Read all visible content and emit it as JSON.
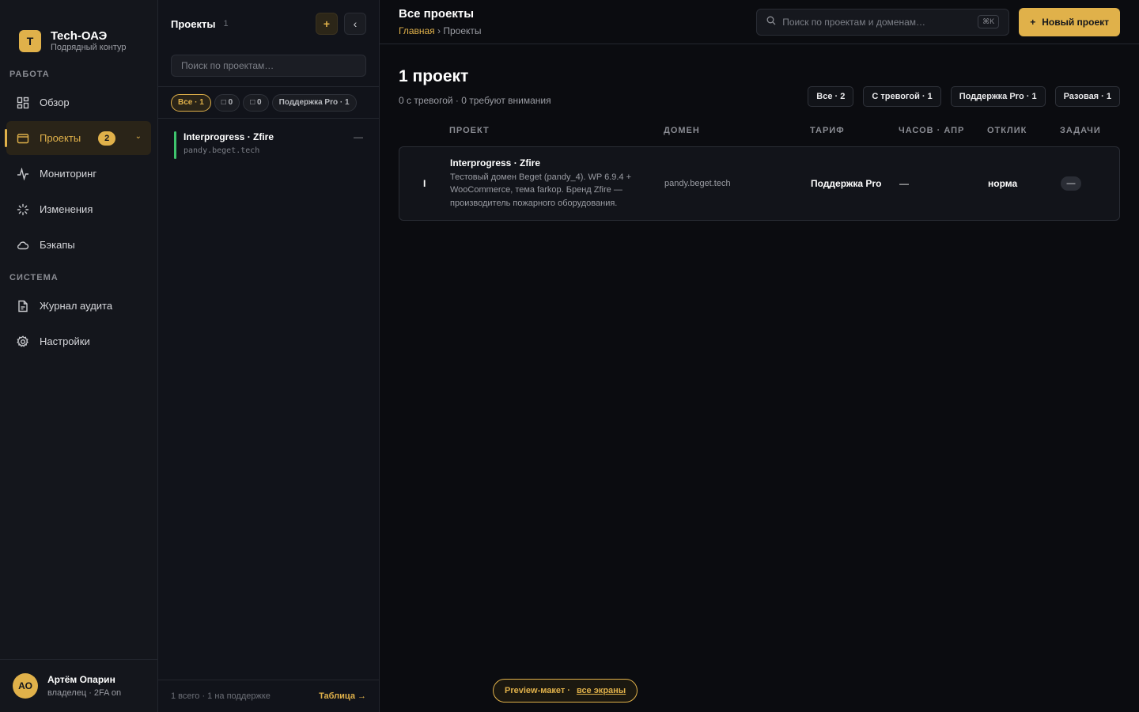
{
  "brand": {
    "logo_letter": "T",
    "title": "Tech-ОАЭ",
    "subtitle": "Подрядный контур"
  },
  "sidebar": {
    "section_work": "РАБОТА",
    "section_system": "СИСТЕМА",
    "items": [
      {
        "label": "Обзор",
        "icon": "grid-icon"
      },
      {
        "label": "Проекты",
        "icon": "folder-icon",
        "badge": "2",
        "active": true
      },
      {
        "label": "Мониторинг",
        "icon": "pulse-icon"
      },
      {
        "label": "Изменения",
        "icon": "loader-icon"
      },
      {
        "label": "Бэкапы",
        "icon": "cloud-icon"
      },
      {
        "label": "Журнал аудита",
        "icon": "file-icon"
      },
      {
        "label": "Настройки",
        "icon": "gear-icon"
      }
    ]
  },
  "user": {
    "initials": "АО",
    "name": "Артём Опарин",
    "role": "владелец · 2FA on"
  },
  "panel": {
    "title": "Проекты",
    "count": "1",
    "add_label": "+",
    "collapse_label": "‹",
    "search_placeholder": "Поиск по проектам…",
    "filters": [
      "Все · 1",
      "□ 0",
      "□ 0",
      "Поддержка Pro · 1"
    ],
    "projects": [
      {
        "name": "Interprogress · Zfire",
        "domain": "pandy.beget.tech",
        "status_color": "#3ec46d",
        "marker": "—"
      }
    ],
    "footer_stat": "1 всего · 1 на поддержке",
    "footer_link": "Таблица →"
  },
  "topbar": {
    "title": "Все проекты",
    "breadcrumb_home": "Главная",
    "breadcrumb_sep": " › ",
    "breadcrumb_current": "Проекты",
    "search_placeholder": "Поиск по проектам и доменам…",
    "search_kbd": "⌘K",
    "new_button": "Новый проект",
    "new_button_icon": "+"
  },
  "main": {
    "title": "1 проект",
    "subtitle": "0 с тревогой · 0 требуют внимания",
    "filters": [
      "Все · 2",
      "С тревогой · 1",
      "Поддержка Pro · 1",
      "Разовая · 1"
    ]
  },
  "table": {
    "columns": [
      "ПРОЕКТ",
      "ДОМЕН",
      "ТАРИФ",
      "ЧАСОВ · АПР",
      "ОТКЛИК",
      "ЗАДАЧИ"
    ],
    "rows": [
      {
        "indicator": "I",
        "name": "Interprogress · Zfire",
        "description": "Тестовый домен Beget (pandy_4). WP 6.9.4 + WooCommerce, тема farkop. Бренд Zfire — производитель пожарного оборудования.",
        "domain": "pandy.beget.tech",
        "tariff": "Поддержка Pro",
        "hours": "—",
        "response": "норма",
        "tasks": "—"
      }
    ]
  },
  "preview": {
    "label": "Preview-макет ·",
    "link": "все экраны"
  },
  "colors": {
    "accent": "#e0b14a",
    "status_ok": "#3ec46d",
    "background": "#0b0c10"
  }
}
